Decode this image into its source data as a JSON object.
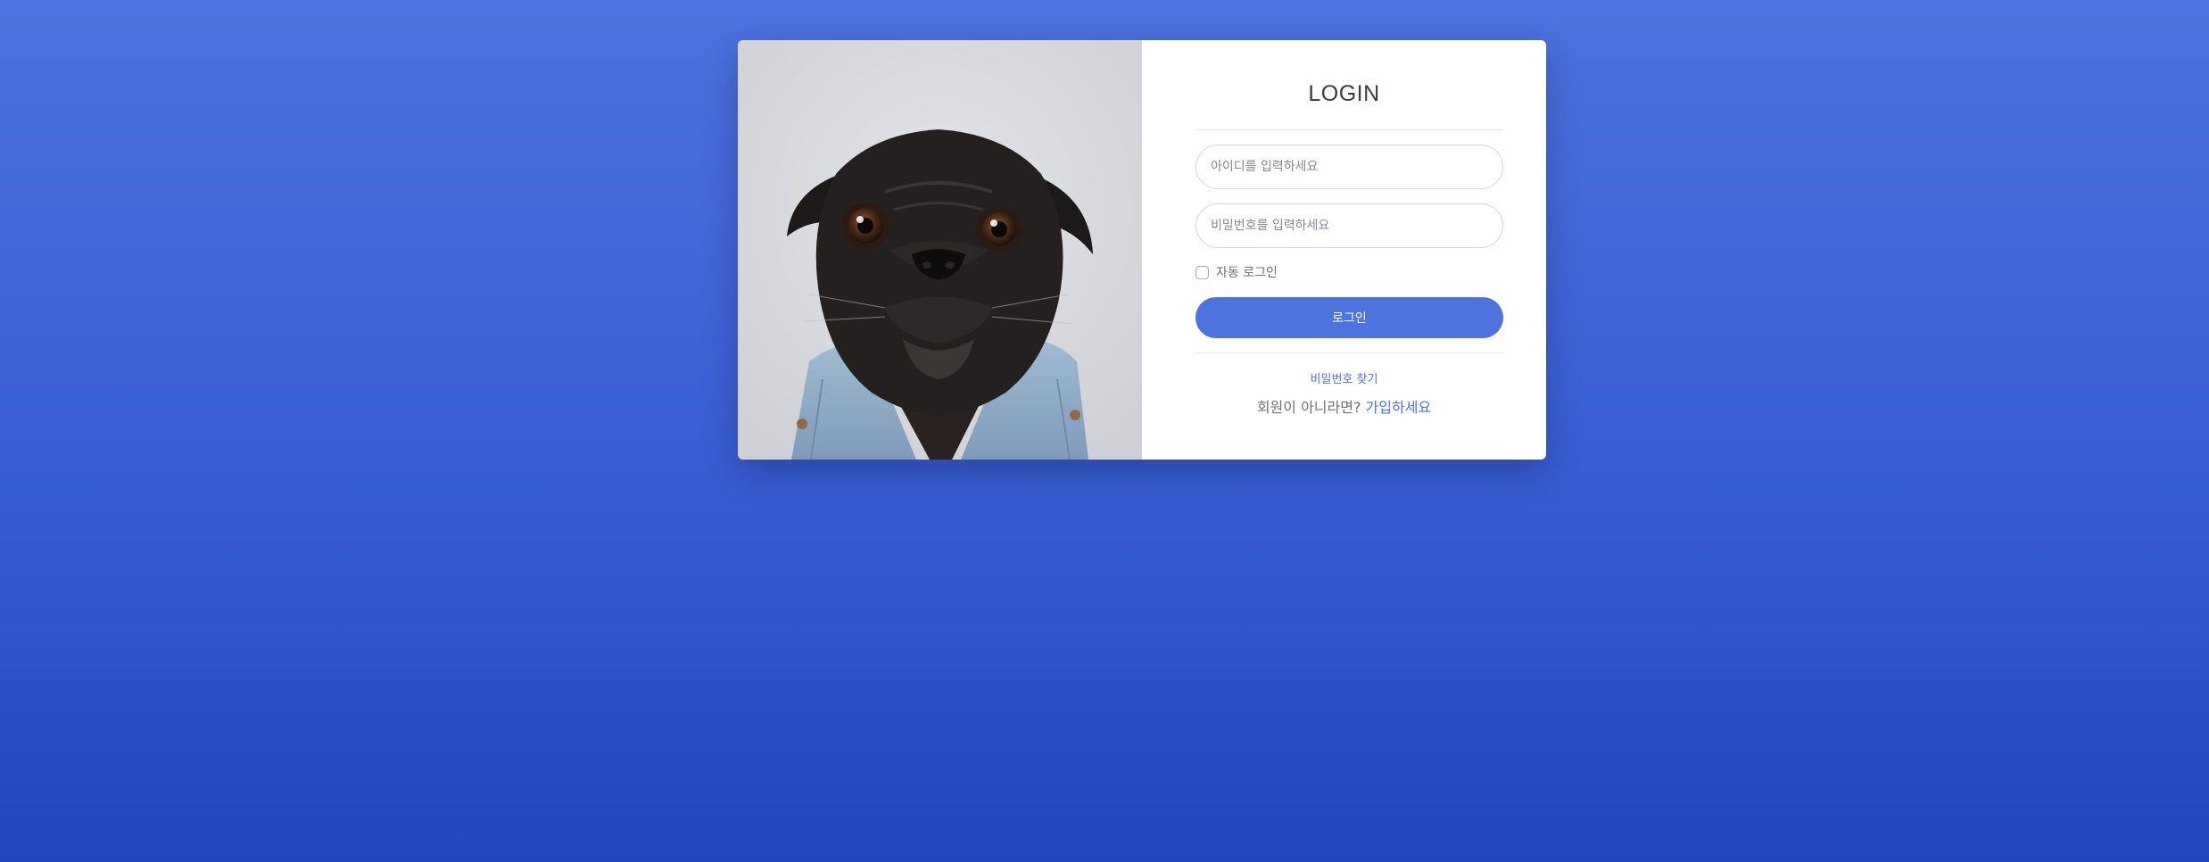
{
  "login": {
    "title": "LOGIN",
    "id_placeholder": "아이디를 입력하세요",
    "password_placeholder": "비밀번호를 입력하세요",
    "remember_label": "자동 로그인",
    "submit_label": "로그인",
    "forgot_password": "비밀번호 찾기",
    "signup_prompt": "회원이 아니라면?",
    "signup_link": "가입하세요"
  },
  "image": {
    "icon": "pug-dog-photo"
  },
  "colors": {
    "accent": "#4e73df",
    "background_top": "#4e73df",
    "background_bottom": "#2446bd",
    "card": "#ffffff",
    "text_muted": "#6e707e"
  }
}
